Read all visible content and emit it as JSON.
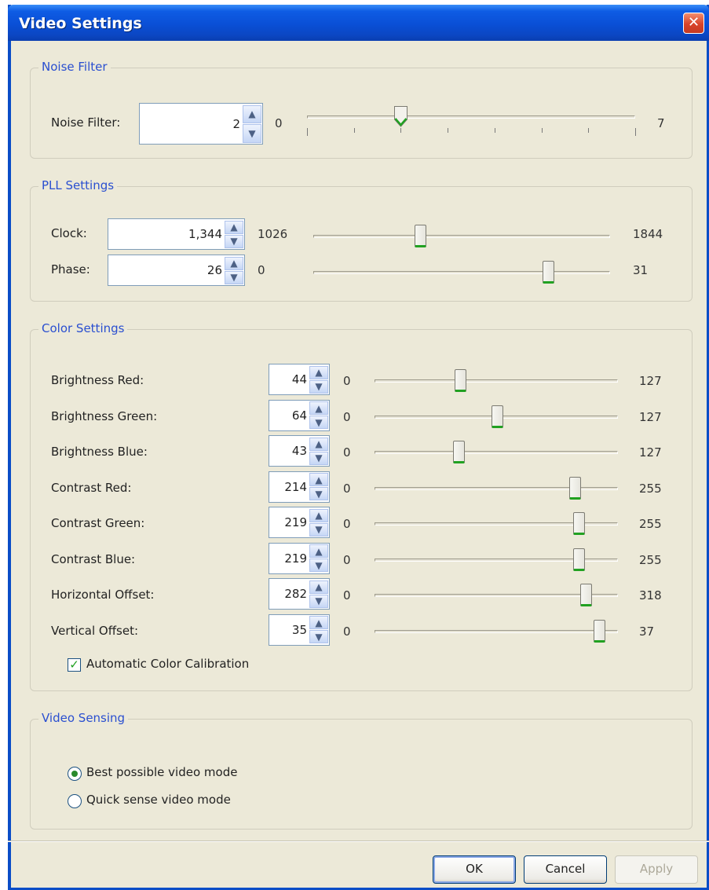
{
  "window": {
    "title": "Video Settings",
    "close_glyph": "✕"
  },
  "noise_filter": {
    "legend": "Noise Filter",
    "label": "Noise Filter:",
    "value": "2",
    "min": "0",
    "max": "7",
    "level": 2,
    "range": [
      0,
      7
    ]
  },
  "pll": {
    "legend": "PLL Settings",
    "clock": {
      "label": "Clock:",
      "value": "1,344",
      "min": "1026",
      "max": "1844",
      "level": 1344,
      "range": [
        1026,
        1844
      ]
    },
    "phase": {
      "label": "Phase:",
      "value": "26",
      "min": "0",
      "max": "31",
      "level": 26,
      "range": [
        0,
        31
      ]
    }
  },
  "color": {
    "legend": "Color Settings",
    "rows": [
      {
        "label": "Brightness Red:",
        "value": "44",
        "min": "0",
        "max": "127",
        "level": 44,
        "range": [
          0,
          127
        ]
      },
      {
        "label": "Brightness Green:",
        "value": "64",
        "min": "0",
        "max": "127",
        "level": 64,
        "range": [
          0,
          127
        ]
      },
      {
        "label": "Brightness Blue:",
        "value": "43",
        "min": "0",
        "max": "127",
        "level": 43,
        "range": [
          0,
          127
        ]
      },
      {
        "label": "Contrast Red:",
        "value": "214",
        "min": "0",
        "max": "255",
        "level": 214,
        "range": [
          0,
          255
        ]
      },
      {
        "label": "Contrast Green:",
        "value": "219",
        "min": "0",
        "max": "255",
        "level": 219,
        "range": [
          0,
          255
        ]
      },
      {
        "label": "Contrast Blue:",
        "value": "219",
        "min": "0",
        "max": "255",
        "level": 219,
        "range": [
          0,
          255
        ]
      },
      {
        "label": "Horizontal Offset:",
        "value": "282",
        "min": "0",
        "max": "318",
        "level": 282,
        "range": [
          0,
          318
        ]
      },
      {
        "label": "Vertical Offset:",
        "value": "35",
        "min": "0",
        "max": "37",
        "level": 35,
        "range": [
          0,
          37
        ]
      }
    ],
    "auto_calibration": {
      "label": "Automatic Color Calibration",
      "checked": true
    }
  },
  "video_sensing": {
    "legend": "Video Sensing",
    "options": [
      {
        "label": "Best possible video mode",
        "selected": true
      },
      {
        "label": "Quick sense video mode",
        "selected": false
      }
    ]
  },
  "buttons": {
    "ok": "OK",
    "cancel": "Cancel",
    "apply": "Apply"
  },
  "colors": {
    "title_bar": "#0a4fd6",
    "legend_text": "#2a4fd0",
    "thumb_accent": "#21a121",
    "window_bg": "#ece9d8"
  }
}
